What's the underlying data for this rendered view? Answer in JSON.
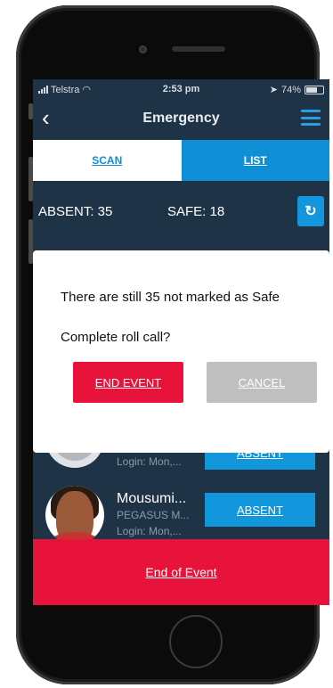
{
  "status_bar": {
    "carrier": "Telstra",
    "time": "2:53 pm",
    "battery": "74%",
    "battery_level": 0.74
  },
  "nav": {
    "title": "Emergency",
    "back_icon": "chevron-left-icon",
    "menu_icon": "hamburger-menu-icon"
  },
  "tabs": [
    {
      "label": "SCAN",
      "active": true
    },
    {
      "label": "LIST",
      "active": false
    }
  ],
  "counts": {
    "absent": "ABSENT: 35",
    "safe": "SAFE: 18",
    "refresh_icon": "refresh-icon"
  },
  "people": [
    {
      "name": "",
      "org": "",
      "login": "Login: Mon,...",
      "status_label": "ABSENT"
    },
    {
      "name": "Mousumi...",
      "org": "PEGASUS M...",
      "login": "Login: Mon,...",
      "status_label": "ABSENT"
    }
  ],
  "dialog": {
    "message": "There are still 35 not marked as Safe",
    "question": "Complete roll call?",
    "confirm_label": "END EVENT",
    "cancel_label": "CANCEL"
  },
  "footer": {
    "end_label": "End of Event"
  },
  "colors": {
    "accent": "#0f8fd6",
    "danger": "#e8133a",
    "background": "#1f3347",
    "cancel": "#bfbfbf"
  }
}
